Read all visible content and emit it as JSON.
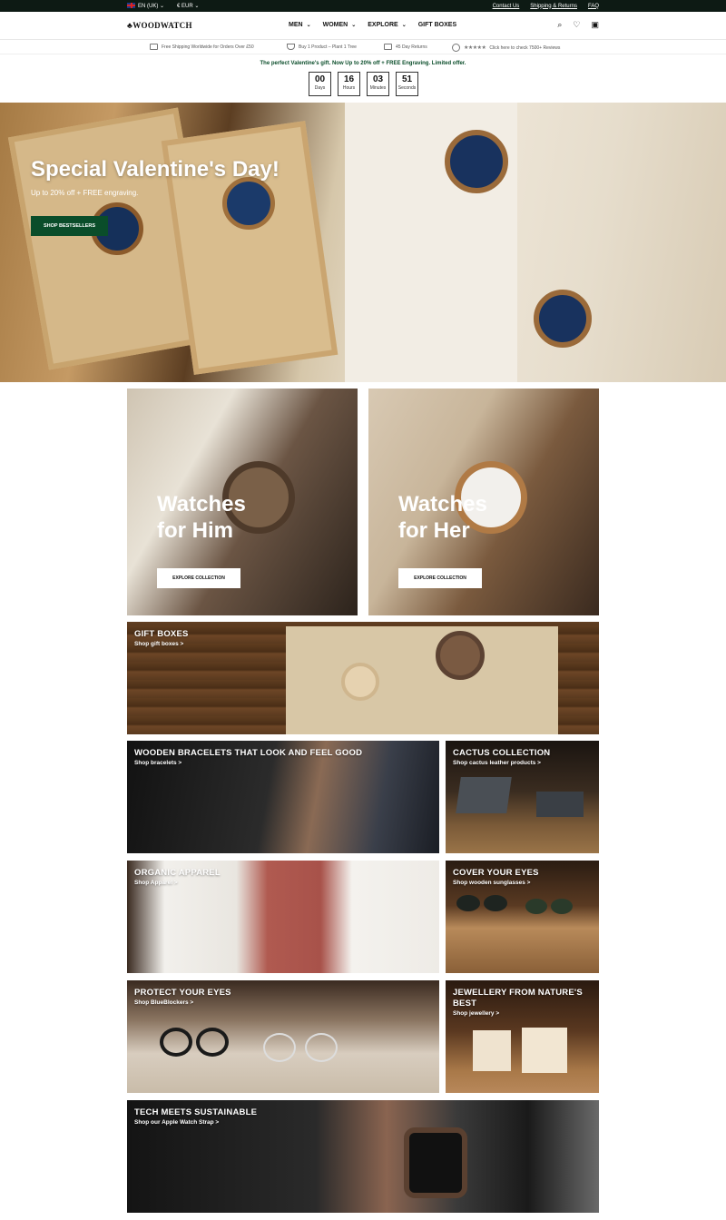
{
  "topbar": {
    "language": "EN (UK)",
    "currency": "€ EUR",
    "links": [
      "Contact Us",
      "Shipping & Returns",
      "FAQ"
    ]
  },
  "nav": {
    "logo": "WOODWATCH",
    "menu": [
      {
        "label": "MEN",
        "has_dropdown": true
      },
      {
        "label": "WOMEN",
        "has_dropdown": true
      },
      {
        "label": "EXPLORE",
        "has_dropdown": true
      },
      {
        "label": "GIFT BOXES",
        "has_dropdown": false
      }
    ],
    "icons": [
      "search-icon",
      "heart-icon",
      "bag-icon"
    ]
  },
  "usp": {
    "items": [
      "Free Shipping Worldwide for Orders Over £50",
      "Buy 1 Product – Plant 1 Tree",
      "45 Day Returns"
    ],
    "reviews": "Click here to check 7500+ Reviews",
    "rating": 4.5
  },
  "promo": {
    "text": "The perfect Valentine's gift. Now Up to 20% off + FREE Engraving. Limited offer.",
    "countdown": [
      {
        "value": "00",
        "label": "Days"
      },
      {
        "value": "16",
        "label": "Hours"
      },
      {
        "value": "03",
        "label": "Minutes"
      },
      {
        "value": "51",
        "label": "Seconds"
      }
    ]
  },
  "hero": {
    "title": "Special Valentine's Day!",
    "subtitle": "Up to 20% off + FREE engraving.",
    "button": "SHOP BESTSELLERS"
  },
  "collections": [
    {
      "title_line1": "Watches",
      "title_line2": "for Him",
      "button": "EXPLORE COLLECTION"
    },
    {
      "title_line1": "Watches",
      "title_line2": "for Her",
      "button": "EXPLORE COLLECTION"
    }
  ],
  "categories": {
    "gift_boxes": {
      "title": "GIFT BOXES",
      "link": "Shop gift boxes >"
    },
    "bracelets": {
      "title": "WOODEN BRACELETS THAT LOOK AND FEEL GOOD",
      "link": "Shop bracelets >"
    },
    "cactus": {
      "title": "CACTUS COLLECTION",
      "link": "Shop cactus leather products >"
    },
    "apparel": {
      "title": "ORGANIC APPAREL",
      "link": "Shop Apparel >"
    },
    "sunglasses": {
      "title": "COVER YOUR EYES",
      "link": "Shop wooden sunglasses >"
    },
    "blueblockers": {
      "title": "PROTECT YOUR EYES",
      "link": "Shop BlueBlockers >"
    },
    "jewellery": {
      "title": "JEWELLERY FROM NATURE'S BEST",
      "link": "Shop jewellery >"
    },
    "tech": {
      "title": "TECH MEETS SUSTAINABLE",
      "link": "Shop our Apple Watch Strap >"
    }
  }
}
